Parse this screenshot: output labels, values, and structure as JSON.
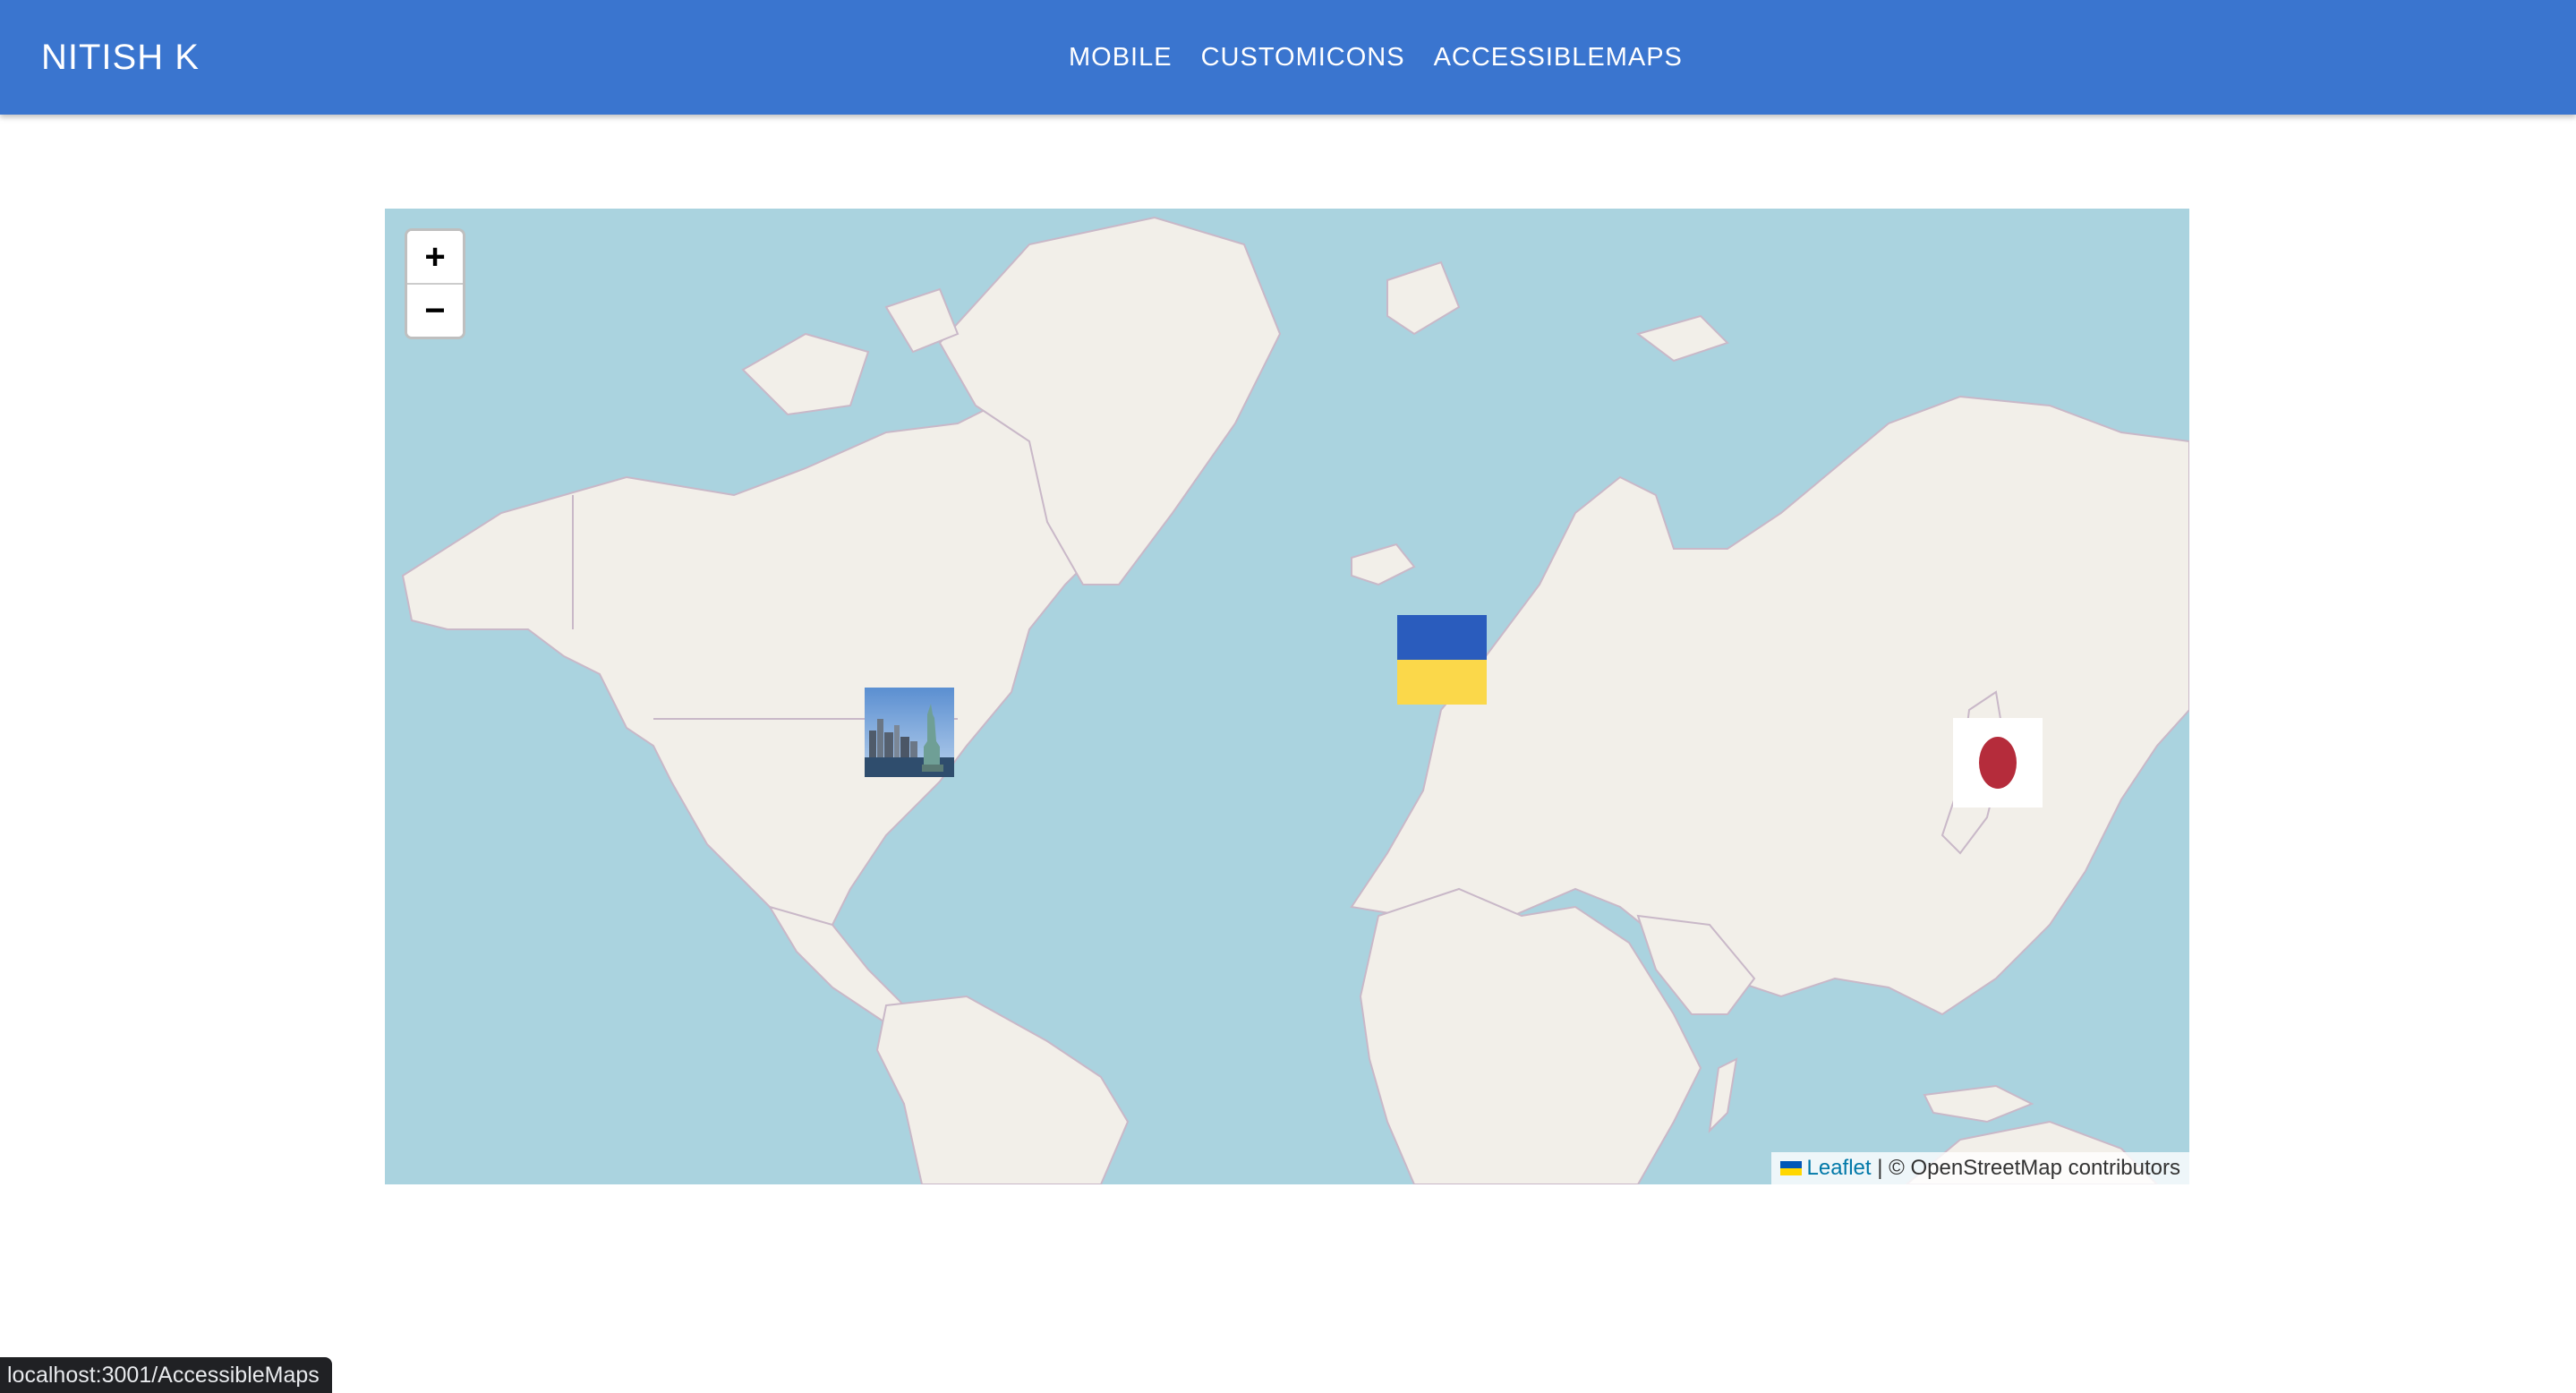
{
  "appbar": {
    "brand": "NITISH K",
    "color": "#3a75cf",
    "nav": [
      {
        "label": "MOBILE"
      },
      {
        "label": "CUSTOMICONS"
      },
      {
        "label": "ACCESSIBLEMAPS"
      }
    ]
  },
  "map": {
    "ocean_color": "#aad3df",
    "land_color": "#f2efe9",
    "zoom": {
      "in_label": "+",
      "out_label": "−"
    },
    "markers": [
      {
        "name": "new-york-marker",
        "icon": "statue-of-liberty-photo"
      },
      {
        "name": "ukraine-marker",
        "icon": "ukraine-flag"
      },
      {
        "name": "japan-marker",
        "icon": "japan-flag"
      }
    ],
    "attribution": {
      "leaflet_label": "Leaflet",
      "separator": "|",
      "osm_text": "© OpenStreetMap contributors"
    }
  },
  "statusbar": {
    "url": "localhost:3001/AccessibleMaps"
  }
}
